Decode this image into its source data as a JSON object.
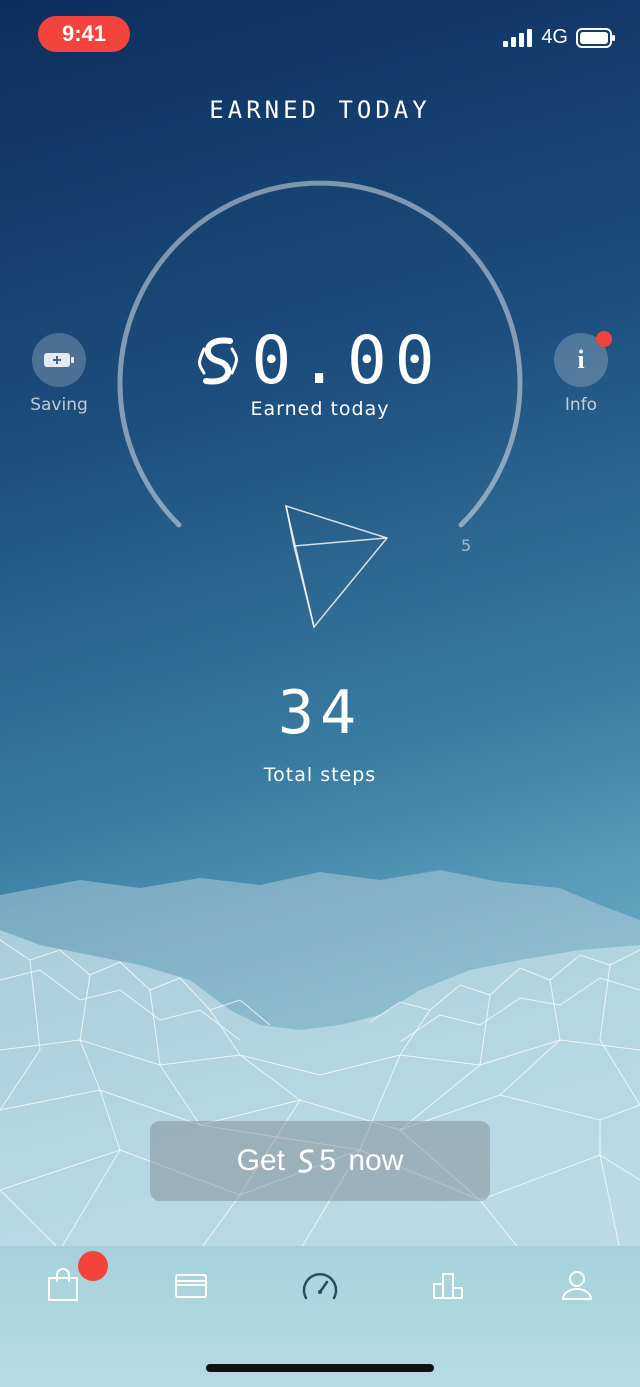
{
  "status": {
    "time": "9:41",
    "network": "4G"
  },
  "header": {
    "title": "EARNED TODAY"
  },
  "earnings": {
    "amount": "0.00",
    "label": "Earned today",
    "gauge_max_label": "5"
  },
  "side": {
    "saving_label": "Saving",
    "info_label": "Info"
  },
  "steps": {
    "count": "34",
    "label": "Total steps"
  },
  "cta": {
    "prefix": "Get ",
    "amount": "5",
    "suffix": " now"
  },
  "tabs": [
    {
      "icon": "shopping-bag-icon",
      "badge": true
    },
    {
      "icon": "wallet-icon"
    },
    {
      "icon": "speedometer-icon",
      "active": true
    },
    {
      "icon": "leaderboard-icon"
    },
    {
      "icon": "profile-icon"
    }
  ],
  "colors": {
    "badge": "#f2443c",
    "background_top": "#0c2e5e",
    "background_bottom": "#9bcfdc"
  }
}
